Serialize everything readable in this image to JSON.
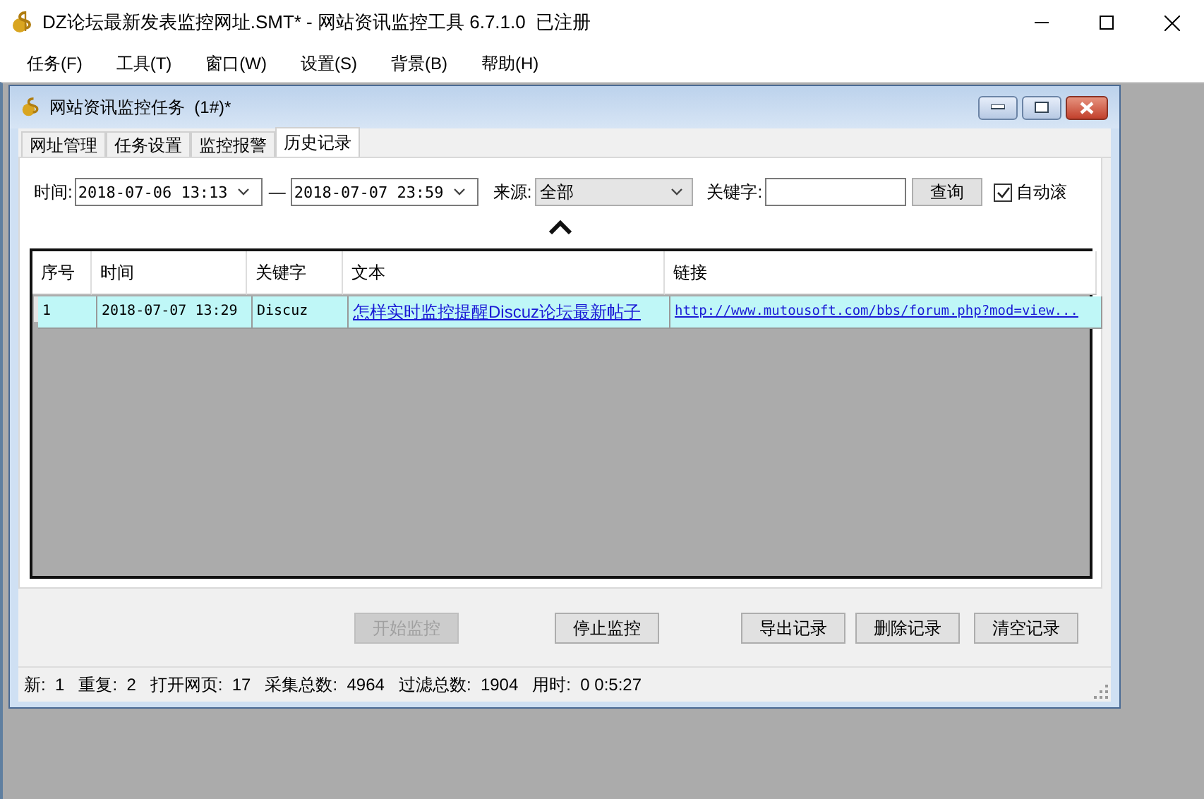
{
  "window": {
    "title": "DZ论坛最新发表监控网址.SMT* - 网站资讯监控工具 6.7.1.0  已注册"
  },
  "menu": [
    "任务(F)",
    "工具(T)",
    "窗口(W)",
    "设置(S)",
    "背景(B)",
    "帮助(H)"
  ],
  "child_window": {
    "title": "网站资讯监控任务  (1#)*"
  },
  "tabs": [
    {
      "label": "网址管理",
      "selected": false
    },
    {
      "label": "任务设置",
      "selected": false
    },
    {
      "label": "监控报警",
      "selected": false
    },
    {
      "label": "历史记录",
      "selected": true
    }
  ],
  "filter": {
    "time_label": "时间:",
    "from": "2018-07-06 13:13",
    "separator": "—",
    "to": "2018-07-07 23:59",
    "source_label": "来源:",
    "source": "全部",
    "keyword_label": "关键字:",
    "query_button": "查询",
    "auto_scroll": {
      "label": "自动滚",
      "checked": true
    }
  },
  "table": {
    "columns": [
      "序号",
      "时间",
      "关键字",
      "文本",
      "链接"
    ],
    "rows": [
      {
        "cells": [
          "1",
          "2018-07-07 13:29",
          "Discuz",
          "怎样实时监控提醒Discuz论坛最新帖子",
          "http://www.mutousoft.com/bbs/forum.php?mod=view..."
        ],
        "selected": true
      }
    ]
  },
  "buttons": [
    {
      "label": "开始监控",
      "disabled": true
    },
    {
      "label": "停止监控",
      "disabled": false
    },
    {
      "label": "导出记录",
      "disabled": false
    },
    {
      "label": "删除记录",
      "disabled": false
    },
    {
      "label": "清空记录",
      "disabled": false
    }
  ],
  "status_bar": [
    "新:  1",
    "重复:  2",
    "打开网页:  17",
    "采集总数:  4964",
    "过滤总数:  1904",
    "用时:  0 0:5:27"
  ]
}
